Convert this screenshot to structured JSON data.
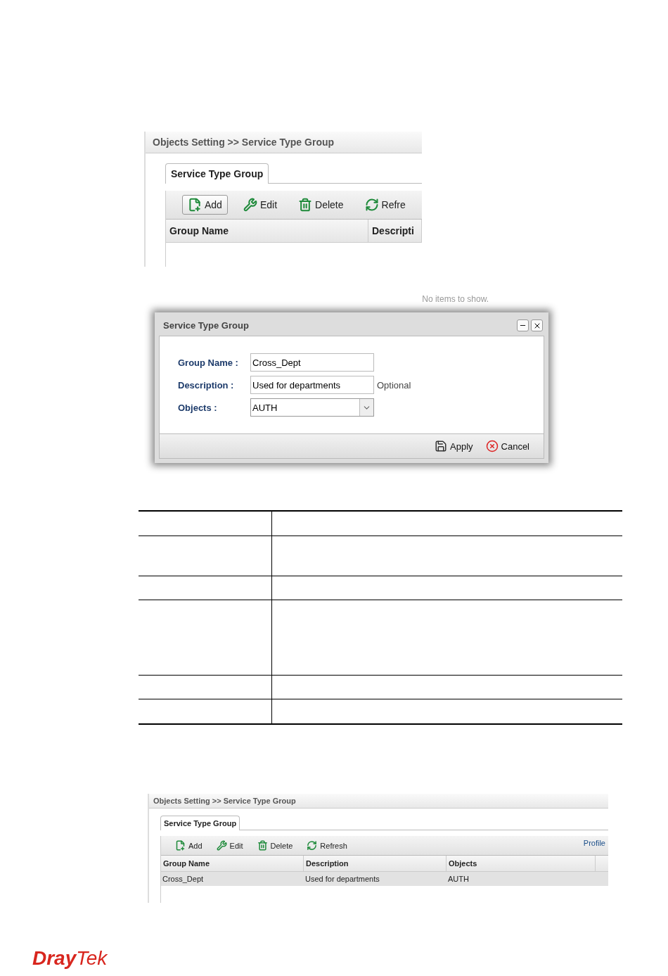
{
  "first_screenshot": {
    "breadcrumb": "Objects Setting >> Service Type Group",
    "tabs": [
      {
        "label": "Service Type Group",
        "selected": true
      }
    ],
    "toolbar": [
      {
        "kind": "add",
        "label": "Add",
        "pressed": true
      },
      {
        "kind": "edit",
        "label": "Edit",
        "pressed": false
      },
      {
        "kind": "delete",
        "label": "Delete",
        "pressed": false
      },
      {
        "kind": "refresh",
        "label": "Refre",
        "pressed": false
      }
    ],
    "columns": [
      "Group Name",
      "Descripti"
    ]
  },
  "dialog": {
    "behind_text": "No items to show.",
    "title": "Service Type Group",
    "fields": [
      {
        "kind": "text",
        "label": "Group Name :",
        "value": "Cross_Dept"
      },
      {
        "kind": "text",
        "label": "Description :",
        "value": "Used for departments",
        "hint": "Optional"
      },
      {
        "kind": "select",
        "label": "Objects :",
        "value": "AUTH"
      }
    ],
    "buttons": [
      {
        "kind": "apply",
        "label": "Apply"
      },
      {
        "kind": "cancel",
        "label": "Cancel"
      }
    ]
  },
  "second_screenshot": {
    "breadcrumb": "Objects Setting >> Service Type Group",
    "tabs": [
      {
        "label": "Service Type Group",
        "selected": true
      }
    ],
    "toolbar": [
      {
        "kind": "add",
        "label": "Add",
        "pressed": false
      },
      {
        "kind": "edit",
        "label": "Edit",
        "pressed": false
      },
      {
        "kind": "delete",
        "label": "Delete",
        "pressed": false
      },
      {
        "kind": "refresh",
        "label": "Refresh",
        "pressed": false
      }
    ],
    "link": "Profile",
    "columns": [
      "Group Name",
      "Description",
      "Objects"
    ],
    "rows": [
      {
        "cells": [
          "Cross_Dept",
          "Used for departments",
          "AUTH"
        ],
        "selected": true
      }
    ]
  },
  "logo": {
    "first": "Dray",
    "second": "Tek"
  }
}
